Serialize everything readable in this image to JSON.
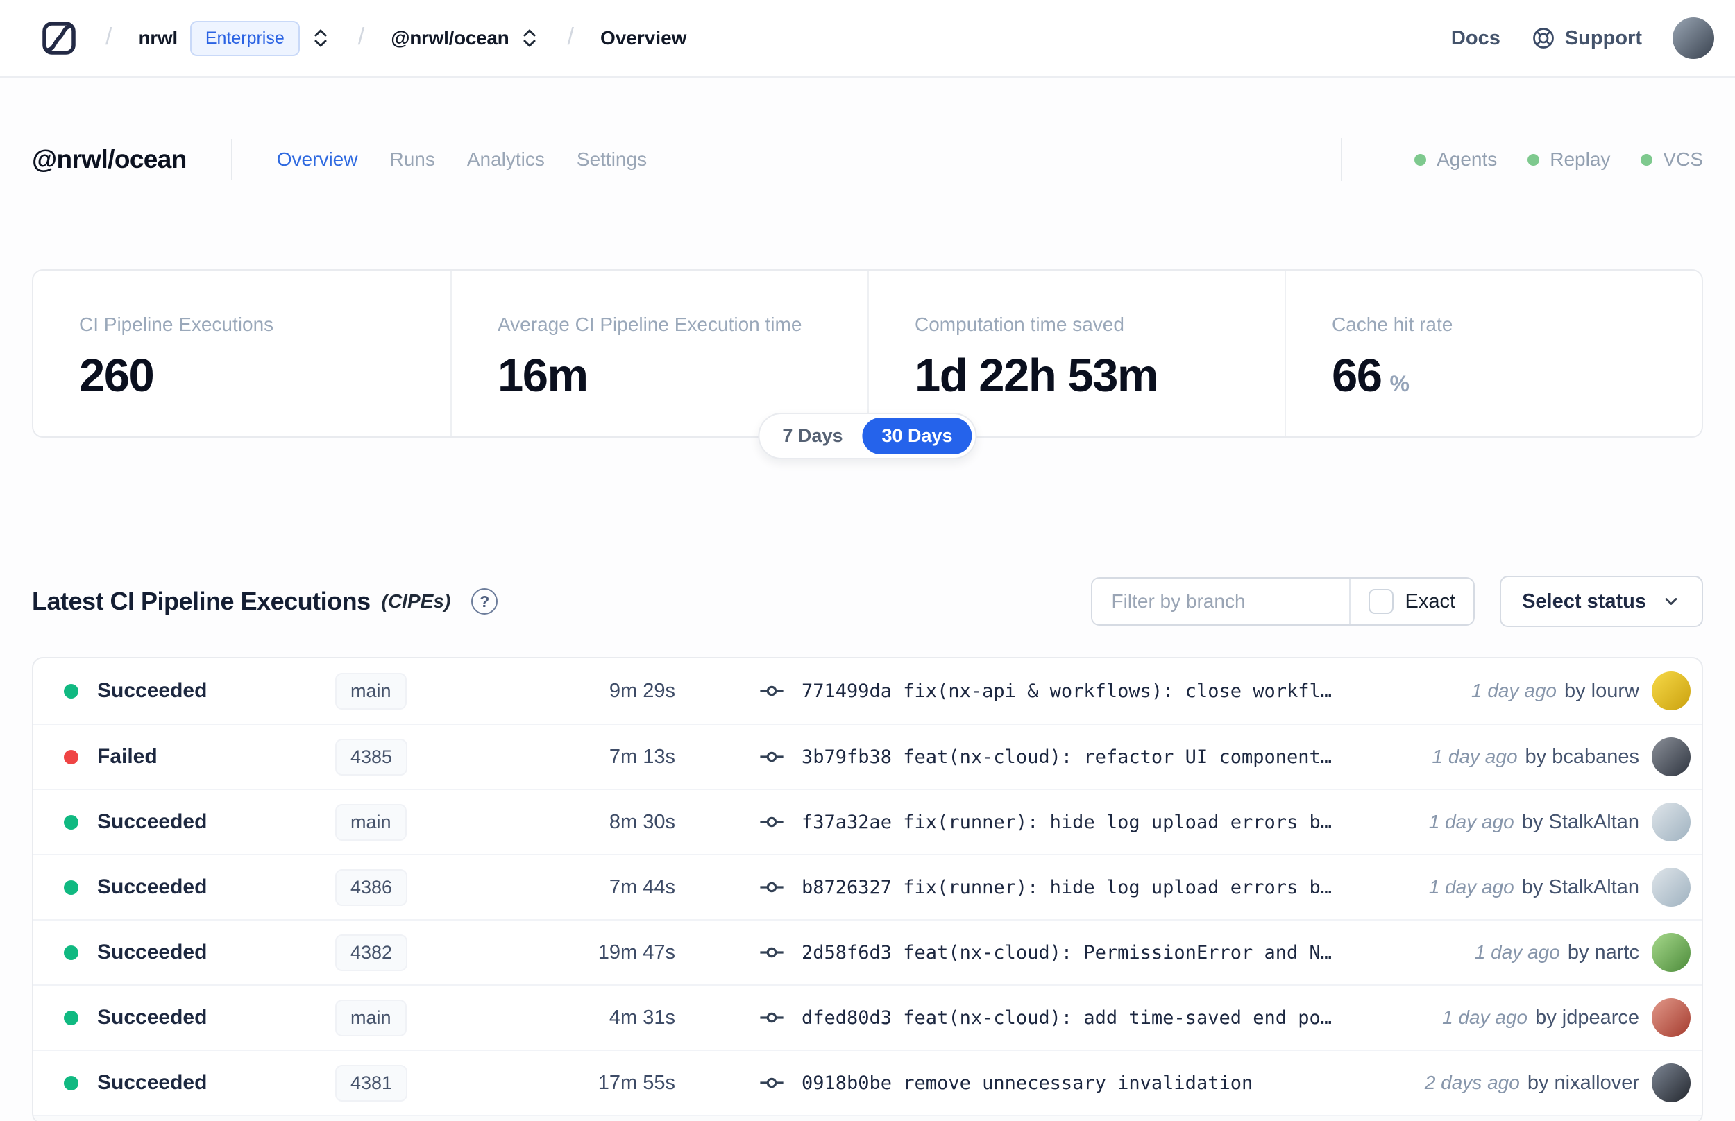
{
  "theme": {
    "accent": "#2563eb",
    "success": "#10b981",
    "danger": "#ef4444",
    "service_green": "#7ec98e"
  },
  "topbar": {
    "breadcrumb": {
      "separator": "/",
      "org": "nrwl",
      "org_badge": "Enterprise",
      "workspace": "@nrwl/ocean",
      "page": "Overview"
    },
    "docs": "Docs",
    "support": "Support",
    "user_avatar_colors": [
      "#9aa6b4",
      "#39424f"
    ]
  },
  "header": {
    "title": "@nrwl/ocean",
    "tabs": [
      {
        "label": "Overview"
      },
      {
        "label": "Runs"
      },
      {
        "label": "Analytics"
      },
      {
        "label": "Settings"
      }
    ],
    "services": [
      {
        "label": "Agents"
      },
      {
        "label": "Replay"
      },
      {
        "label": "VCS"
      }
    ]
  },
  "stats": {
    "cards": [
      {
        "label": "CI Pipeline Executions",
        "value": "260",
        "suffix": ""
      },
      {
        "label": "Average CI Pipeline Execution time",
        "value": "16m",
        "suffix": ""
      },
      {
        "label": "Computation time saved",
        "value": "1d 22h 53m",
        "suffix": ""
      },
      {
        "label": "Cache hit rate",
        "value": "66",
        "suffix": "%"
      }
    ],
    "range": {
      "options": [
        {
          "label": "7 Days"
        },
        {
          "label": "30 Days"
        }
      ],
      "selected": "30 Days"
    }
  },
  "cipes": {
    "title": "Latest CI Pipeline Executions",
    "suffix": "(CIPEs)",
    "help": "?",
    "filter": {
      "placeholder": "Filter by branch",
      "exact": "Exact"
    },
    "status_select": "Select status",
    "rows": [
      {
        "status": "Succeeded",
        "branch": "main",
        "duration": "9m 29s",
        "commit": "771499da fix(nx-api & workflows): close workfl…",
        "time": "1 day ago",
        "author": "by lourw",
        "avatar": [
          "#f7d948",
          "#caa10e"
        ]
      },
      {
        "status": "Failed",
        "branch": "4385",
        "duration": "7m 13s",
        "commit": "3b79fb38 feat(nx-cloud): refactor UI component…",
        "time": "1 day ago",
        "author": "by bcabanes",
        "avatar": [
          "#8b9099",
          "#2f3540"
        ]
      },
      {
        "status": "Succeeded",
        "branch": "main",
        "duration": "8m 30s",
        "commit": "f37a32ae fix(runner): hide log upload errors b…",
        "time": "1 day ago",
        "author": "by StalkAltan",
        "avatar": [
          "#dfe5ea",
          "#9fb2c0"
        ]
      },
      {
        "status": "Succeeded",
        "branch": "4386",
        "duration": "7m 44s",
        "commit": "b8726327 fix(runner): hide log upload errors b…",
        "time": "1 day ago",
        "author": "by StalkAltan",
        "avatar": [
          "#dfe5ea",
          "#9fb2c0"
        ]
      },
      {
        "status": "Succeeded",
        "branch": "4382",
        "duration": "19m 47s",
        "commit": "2d58f6d3 feat(nx-cloud): PermissionError and N…",
        "time": "1 day ago",
        "author": "by nartc",
        "avatar": [
          "#a7d98c",
          "#4c8b3a"
        ]
      },
      {
        "status": "Succeeded",
        "branch": "main",
        "duration": "4m 31s",
        "commit": "dfed80d3 feat(nx-cloud): add time-saved end po…",
        "time": "1 day ago",
        "author": "by jdpearce",
        "avatar": [
          "#e2998a",
          "#a43b2e"
        ]
      },
      {
        "status": "Succeeded",
        "branch": "4381",
        "duration": "17m 55s",
        "commit": "0918b0be remove unnecessary invalidation",
        "time": "2 days ago",
        "author": "by nixallover",
        "avatar": [
          "#7d8694",
          "#23272e"
        ]
      }
    ]
  }
}
